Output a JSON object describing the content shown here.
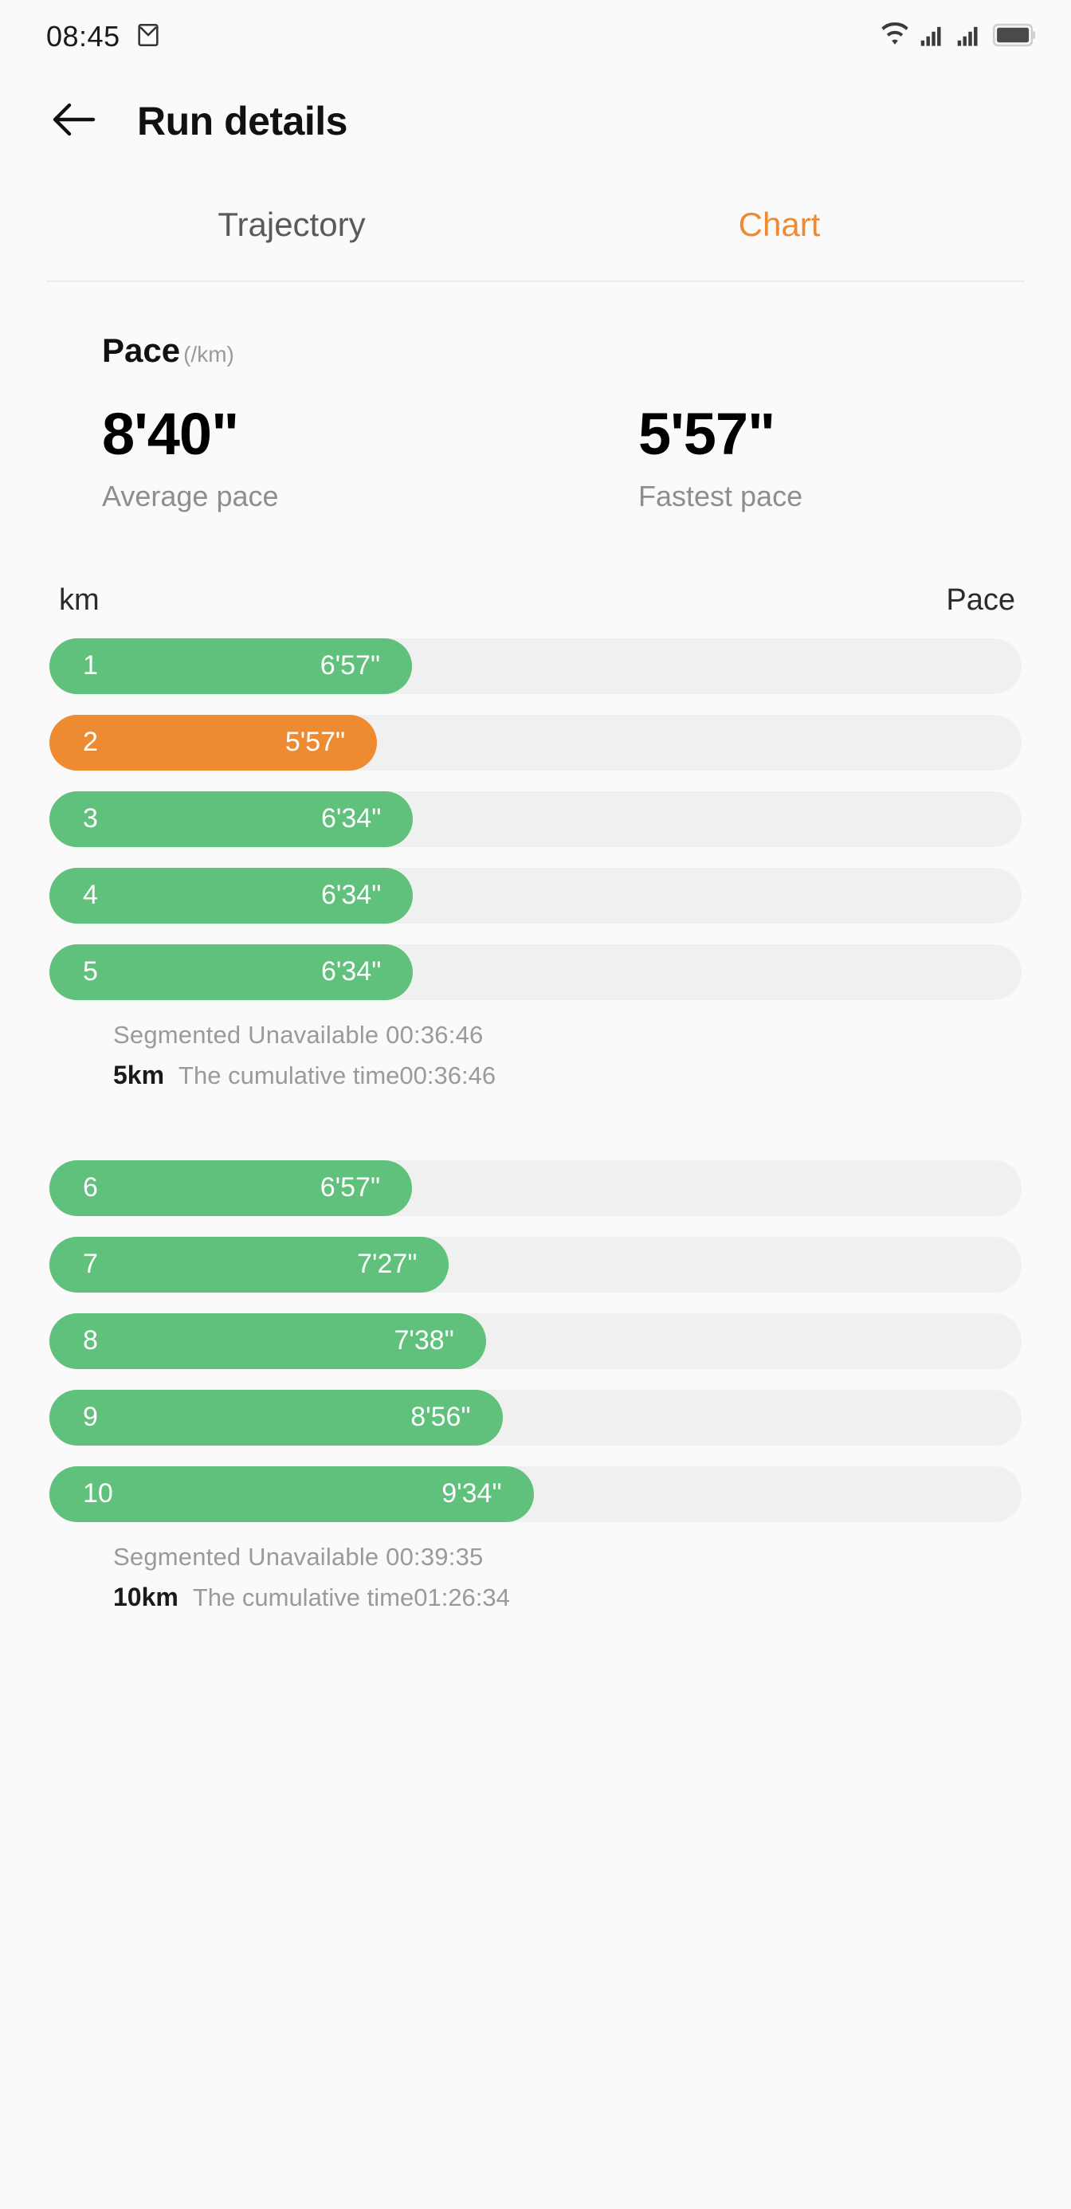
{
  "status_bar": {
    "time": "08:45",
    "icons": [
      "mail-icon",
      "wifi-icon",
      "signal-icon",
      "signal-icon",
      "battery-icon"
    ]
  },
  "header": {
    "back_icon": "back-arrow-icon",
    "title": "Run details"
  },
  "tabs": [
    {
      "label": "Trajectory",
      "active": false
    },
    {
      "label": "Chart",
      "active": true
    }
  ],
  "pace": {
    "title": "Pace",
    "unit": "(/km)",
    "stats": [
      {
        "value": "8'40\"",
        "label": "Average pace"
      },
      {
        "value": "5'57\"",
        "label": "Fastest pace"
      }
    ]
  },
  "table": {
    "col_km": "km",
    "col_pace": "Pace"
  },
  "colors": {
    "accent_orange": "#EE8B32",
    "bar_green": "#5FC17B",
    "track_gray": "#F0F0F0"
  },
  "segments": [
    {
      "rows": [
        {
          "km": "1",
          "pace": "6'57\"",
          "pct": 37.3,
          "fastest": false
        },
        {
          "km": "2",
          "pace": "5'57\"",
          "pct": 33.7,
          "fastest": true
        },
        {
          "km": "3",
          "pace": "6'34\"",
          "pct": 37.4,
          "fastest": false
        },
        {
          "km": "4",
          "pace": "6'34\"",
          "pct": 37.4,
          "fastest": false
        },
        {
          "km": "5",
          "pace": "6'34\"",
          "pct": 37.4,
          "fastest": false
        }
      ],
      "summary_unavailable": "Segmented Unavailable 00:36:46",
      "summary_km": "5km",
      "summary_cumulative": "The cumulative time00:36:46"
    },
    {
      "rows": [
        {
          "km": "6",
          "pace": "6'57\"",
          "pct": 37.3,
          "fastest": false
        },
        {
          "km": "7",
          "pace": "7'27\"",
          "pct": 41.1,
          "fastest": false
        },
        {
          "km": "8",
          "pace": "7'38\"",
          "pct": 44.9,
          "fastest": false
        },
        {
          "km": "9",
          "pace": "8'56\"",
          "pct": 46.6,
          "fastest": false
        },
        {
          "km": "10",
          "pace": "9'34\"",
          "pct": 49.8,
          "fastest": false
        }
      ],
      "summary_unavailable": "Segmented Unavailable 00:39:35",
      "summary_km": "10km",
      "summary_cumulative": "The cumulative time01:26:34"
    }
  ],
  "chart_data": {
    "type": "bar",
    "title": "Pace (/km)",
    "xlabel": "Pace",
    "ylabel": "km",
    "categories": [
      "1",
      "2",
      "3",
      "4",
      "5",
      "6",
      "7",
      "8",
      "9",
      "10"
    ],
    "values": [
      "6'57\"",
      "5'57\"",
      "6'34\"",
      "6'34\"",
      "6'34\"",
      "6'57\"",
      "7'27\"",
      "7'38\"",
      "8'56\"",
      "9'34\""
    ],
    "values_seconds": [
      417,
      357,
      394,
      394,
      394,
      417,
      447,
      458,
      536,
      574
    ],
    "highlight_index": 1,
    "highlight_reason": "fastest pace",
    "average_pace": "8'40\"",
    "fastest_pace": "5'57\"",
    "legend": [],
    "grid": false
  }
}
